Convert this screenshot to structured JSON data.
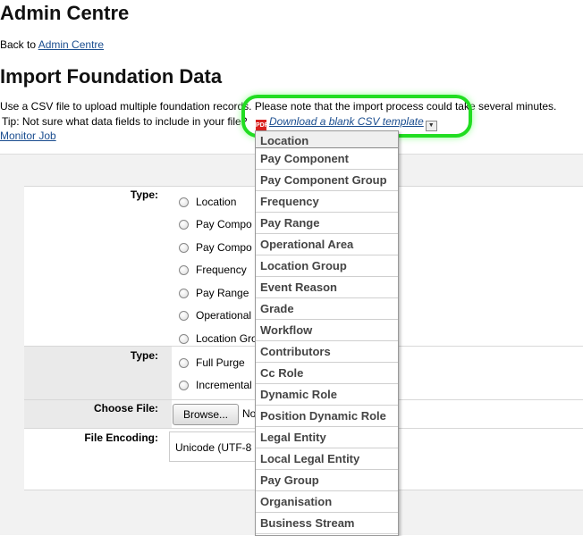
{
  "header": {
    "title": "Admin Centre",
    "back_prefix": "Back to ",
    "back_link": "Admin Centre"
  },
  "main": {
    "title": "Import Foundation Data",
    "description": "Use a CSV file to upload multiple foundation records. Please note that the import process could take several minutes.",
    "tip": "Tip: Not sure what data fields to include in your file?",
    "template_link": "Download a blank CSV template",
    "monitor_link": "Monitor Job"
  },
  "form": {
    "type_label": "Type:",
    "type_options": [
      "Location",
      "Pay Compo",
      "Pay Compo",
      "Frequency",
      "Pay Range",
      "Operational",
      "Location Gro"
    ],
    "purge_label": "Type:",
    "purge_options": [
      "Full Purge",
      "Incremental"
    ],
    "file_label": "Choose File:",
    "browse_button": "Browse...",
    "no_file": "No",
    "encoding_label": "File Encoding:",
    "encoding_value": "Unicode (UTF-8"
  },
  "dropdown": {
    "items": [
      "Location",
      "Pay Component",
      "Pay Component Group",
      "Frequency",
      "Pay Range",
      "Operational Area",
      "Location Group",
      "Event Reason",
      "Grade",
      "Workflow",
      "Contributors",
      "Cc Role",
      "Dynamic Role",
      "Position Dynamic Role",
      "Legal Entity",
      "Local Legal Entity",
      "Pay Group",
      "Organisation",
      "Business Stream"
    ]
  },
  "colors": {
    "highlight": "#22dd22",
    "link": "#1a4d8f"
  }
}
